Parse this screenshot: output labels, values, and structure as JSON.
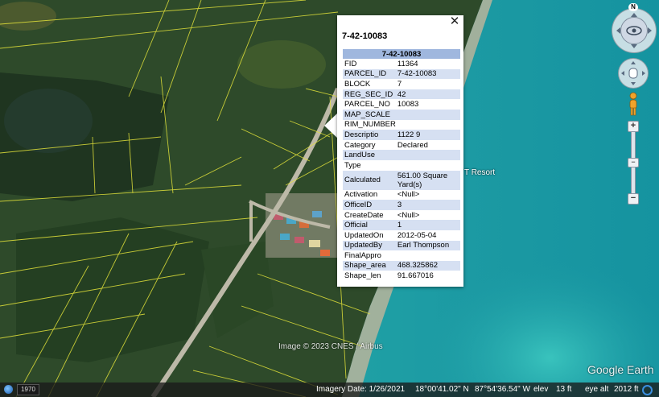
{
  "popup": {
    "title": "7-42-10083",
    "table_header": "7-42-10083",
    "rows": [
      {
        "key": "FID",
        "value": "11364"
      },
      {
        "key": "PARCEL_ID",
        "value": "7-42-10083"
      },
      {
        "key": "BLOCK",
        "value": "7"
      },
      {
        "key": "REG_SEC_ID",
        "value": "42"
      },
      {
        "key": "PARCEL_NO",
        "value": "10083"
      },
      {
        "key": "MAP_SCALE",
        "value": ""
      },
      {
        "key": "RIM_NUMBER",
        "value": ""
      },
      {
        "key": "Descriptio",
        "value": "1122 9"
      },
      {
        "key": "Category",
        "value": "Declared"
      },
      {
        "key": "LandUse",
        "value": ""
      },
      {
        "key": "Type",
        "value": ""
      },
      {
        "key": "Calculated",
        "value": "561.00 Square Yard(s)"
      },
      {
        "key": "Activation",
        "value": "<Null>"
      },
      {
        "key": "OfficeID",
        "value": "3"
      },
      {
        "key": "CreateDate",
        "value": "<Null>"
      },
      {
        "key": "Official",
        "value": "1"
      },
      {
        "key": "UpdatedOn",
        "value": "2012-05-04"
      },
      {
        "key": "UpdatedBy",
        "value": "Earl Thompson"
      },
      {
        "key": "FinalAppro",
        "value": ""
      },
      {
        "key": "Shape_area",
        "value": "468.325862"
      },
      {
        "key": "Shape_len",
        "value": "91.667016"
      }
    ],
    "close_icon": "close-icon"
  },
  "map": {
    "resort_label": "T Resort",
    "copyright": "Image © 2023 CNES / Airbus",
    "brand": "Google Earth"
  },
  "nav": {
    "north": "N",
    "zoom_in": "+",
    "zoom_out": "−",
    "zoom_level": 0.5
  },
  "status": {
    "year": "1970",
    "imagery_date": "Imagery Date: 1/26/2021",
    "lat": "18°00'41.02\" N",
    "lon": "87°54'36.54\" W",
    "elev_label": "elev",
    "elev_value": "13 ft",
    "eye_label": "eye alt",
    "eye_value": "2012 ft"
  }
}
